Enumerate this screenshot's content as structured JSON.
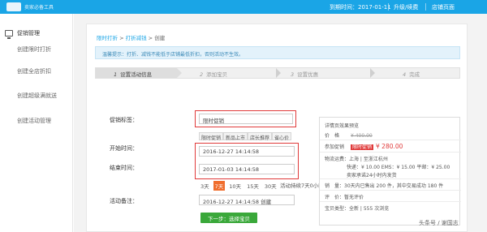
{
  "topbar": {
    "brand": "卖家必备工具",
    "expire": "到期时间：2017-01-11",
    "renew": "升级/续费",
    "shop": "店铺页面"
  },
  "sidebar": {
    "heading": "促销管理",
    "items": [
      "创建限时打折",
      "创建全店折扣",
      "创建超级满就送",
      "创建活动管理"
    ]
  },
  "breadcrumb": {
    "part1": "限时打折",
    "sep1": " > ",
    "part2": "打折减钱",
    "sep2": " > ",
    "part3": "创建"
  },
  "notice": "温馨提示：打折、减钱不能低于店铺最低折扣，否则活动不生效。",
  "steps": [
    {
      "num": "1",
      "label": "设置活动信息"
    },
    {
      "num": "2",
      "label": "添加宝贝"
    },
    {
      "num": "3",
      "label": "设置优惠"
    },
    {
      "num": "4",
      "label": "完成"
    }
  ],
  "form": {
    "promo_tag_label": "促销标签：",
    "promo_tag_value": "限时促销",
    "tags": [
      "限时促销",
      "新品上市",
      "店长推荐",
      "省心价"
    ],
    "start_label": "开始时间：",
    "start_value": "2016-12-27 14:14:58",
    "end_label": "结束时间：",
    "end_value": "2017-01-03 14:14:58",
    "days": [
      "3天",
      "7天",
      "10天",
      "15天",
      "30天"
    ],
    "selected_day": "7天",
    "duration": "活动持续7天0小时",
    "remark_label": "活动备注：",
    "remark_value": "2016-12-27 14:14:58 创建",
    "next_button": "下一步：选择宝贝"
  },
  "preview": {
    "title": "详情页效果预览",
    "price_label": "价　格",
    "price_value": "¥ 400.00",
    "promo_label": "参加促销",
    "promo_badge": "限时促销",
    "promo_price": "¥ 280.00",
    "logistics_label": "物流运费：",
    "logistics_value": "上海 | 至浙江杭州",
    "shipping": "快递：¥ 10.00 EMS：¥ 15.00 平邮：¥ 25.00",
    "promise": "卖家承诺24小时内发货",
    "sales_label": "销　量：",
    "sales_value": "30天内已售出 200 件，其中交易成功 180 件",
    "review_label": "评　价：",
    "review_value": "暂无评价",
    "type_label": "宝贝类型：",
    "type_value": "全新 | 555 次浏览"
  },
  "watermark": "头条号 / 谢国志",
  "colors": {
    "topbar": "#1aa5e6",
    "highlight_box": "#e03a3a",
    "selected_day": "#f06e2e",
    "next_button": "#3aa83a",
    "price": "#e03a3a"
  }
}
